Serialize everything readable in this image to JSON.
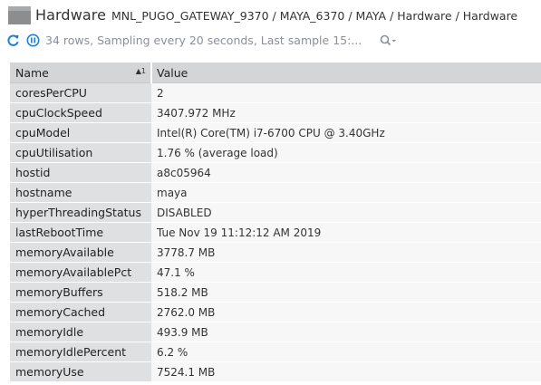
{
  "header": {
    "title": "Hardware",
    "breadcrumb": "MNL_PUGO_GATEWAY_9370 / MAYA_6370 / MAYA / Hardware / Hardware"
  },
  "toolbar": {
    "status": "34 rows, Sampling every 20 seconds, Last sample 15:...",
    "refresh_icon": "refresh-icon",
    "pause_icon": "pause-icon",
    "search_icon": "search-icon",
    "accent_color": "#1f7fd1"
  },
  "table": {
    "columns": [
      {
        "label": "Name",
        "sort": "1"
      },
      {
        "label": "Value"
      }
    ],
    "rows": [
      {
        "name": "coresPerCPU",
        "value": "2"
      },
      {
        "name": "cpuClockSpeed",
        "value": "3407.972 MHz"
      },
      {
        "name": "cpuModel",
        "value": "Intel(R) Core(TM) i7-6700 CPU @ 3.40GHz"
      },
      {
        "name": "cpuUtilisation",
        "value": "1.76 % (average load)"
      },
      {
        "name": "hostid",
        "value": "a8c05964"
      },
      {
        "name": "hostname",
        "value": "maya"
      },
      {
        "name": "hyperThreadingStatus",
        "value": "DISABLED"
      },
      {
        "name": "lastRebootTime",
        "value": "Tue Nov 19 11:12:12 AM 2019"
      },
      {
        "name": "memoryAvailable",
        "value": "3778.7 MB"
      },
      {
        "name": "memoryAvailablePct",
        "value": "47.1 %"
      },
      {
        "name": "memoryBuffers",
        "value": "518.2 MB"
      },
      {
        "name": "memoryCached",
        "value": "2762.0 MB"
      },
      {
        "name": "memoryIdle",
        "value": "493.9 MB"
      },
      {
        "name": "memoryIdlePercent",
        "value": "6.2 %"
      },
      {
        "name": "memoryUse",
        "value": "7524.1 MB"
      }
    ]
  }
}
